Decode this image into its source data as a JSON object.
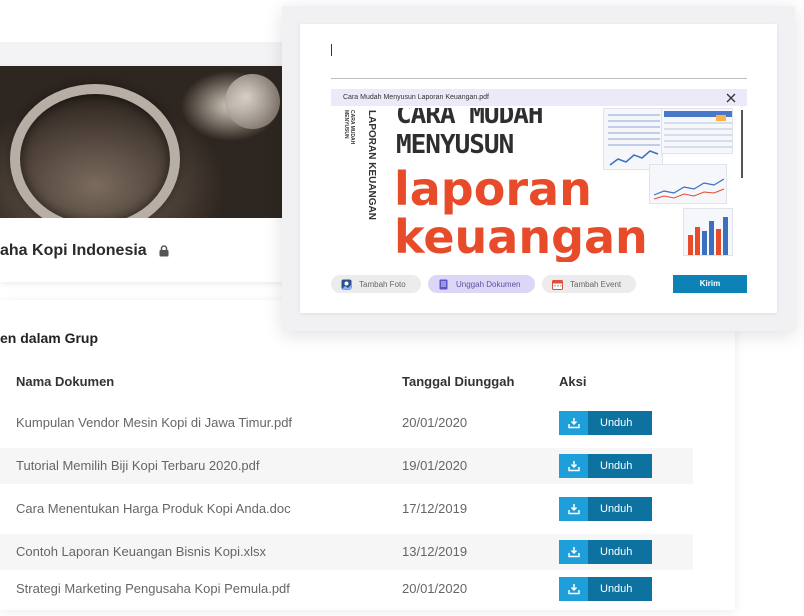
{
  "group": {
    "name": "aha Kopi Indonesia",
    "lock_icon": "lock-icon"
  },
  "documents": {
    "title": "en dalam Grup",
    "headers": {
      "name": "Nama Dokumen",
      "date": "Tanggal Diunggah",
      "action": "Aksi"
    },
    "download_label": "Unduh",
    "rows": [
      {
        "name": "Kumpulan Vendor Mesin Kopi di Jawa Timur.pdf",
        "date": "20/01/2020"
      },
      {
        "name": "Tutorial Memilih Biji Kopi Terbaru 2020.pdf",
        "date": "19/01/2020"
      },
      {
        "name": "Cara Menentukan Harga Produk Kopi Anda.doc",
        "date": "17/12/2019"
      },
      {
        "name": "Contoh Laporan Keuangan Bisnis Kopi.xlsx",
        "date": "13/12/2019"
      },
      {
        "name": "Strategi Marketing Pengusaha Kopi Pemula.pdf",
        "date": "20/01/2020"
      }
    ]
  },
  "composer": {
    "input_value": "",
    "attachment": {
      "file_name": "Cara Mudah Menyusun Laporan Keuangan.pdf"
    },
    "preview": {
      "spine_top": "CARA MUDAH",
      "spine_sub": "MENYUSUN",
      "spine_main": "LAPORAN KEUANGAN",
      "line1": "CARA MUDAH",
      "line2": "MENYUSUN",
      "line3": "laporan",
      "line4": "keuangan"
    },
    "tools": {
      "photo": "Tambah Foto",
      "document": "Unggah Dokumen",
      "event": "Tambah Event"
    },
    "send_label": "Kirim"
  },
  "colors": {
    "accent": "#0d72a0",
    "accent_light": "#1e9fd9",
    "tool_active": "#dcd6f7"
  }
}
